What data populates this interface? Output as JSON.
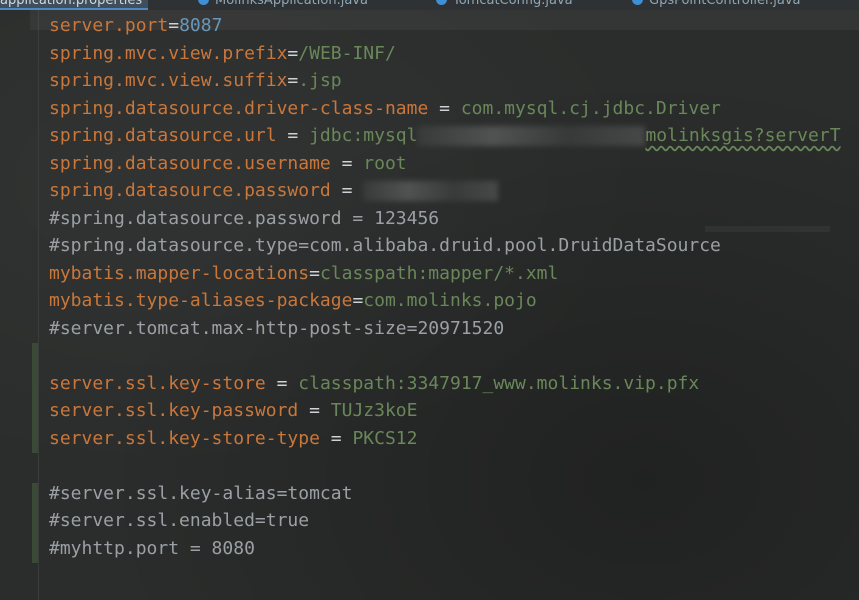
{
  "tabs": [
    {
      "label": "application.properties",
      "icon": "properties-file-icon",
      "active": true
    },
    {
      "label": "MolinksApplication.java",
      "icon": "java-class-icon",
      "active": false
    },
    {
      "label": "TomcatConfig.java",
      "icon": "java-class-icon",
      "active": false
    },
    {
      "label": "GpsPointController.java",
      "icon": "java-class-icon",
      "active": false
    }
  ],
  "lines": [
    {
      "key": "server.port",
      "sep": "=",
      "value": "8087"
    },
    {
      "key": "spring.mvc.view.prefix",
      "sep": "=",
      "value": "/WEB-INF/"
    },
    {
      "key": "spring.mvc.view.suffix",
      "sep": "=",
      "value": ".jsp"
    },
    {
      "key": "spring.datasource.driver-class-name",
      "sep": " = ",
      "value": "com.mysql.cj.jdbc.Driver"
    },
    {
      "key": "spring.datasource.url",
      "sep": " = ",
      "value": "jdbc:mysql",
      "value_tail": "molinksgis?serverT"
    },
    {
      "key": "spring.datasource.username",
      "sep": " = ",
      "value": "root"
    },
    {
      "key": "spring.datasource.password",
      "sep": " = ",
      "value": ""
    },
    {
      "comment": "#spring.datasource.password = 123456"
    },
    {
      "comment": "#spring.datasource.type=com.alibaba.druid.pool.DruidDataSource"
    },
    {
      "key": "mybatis.mapper-locations",
      "sep": "=",
      "value": "classpath:mapper/*.xml"
    },
    {
      "key": "mybatis.type-aliases-package",
      "sep": "=",
      "value": "com.molinks.pojo"
    },
    {
      "comment": "#server.tomcat.max-http-post-size=20971520"
    },
    {
      "blank": true
    },
    {
      "key": "server.ssl.key-store",
      "sep": " = ",
      "value": "classpath:3347917_www.molinks.vip.pfx"
    },
    {
      "key": "server.ssl.key-password",
      "sep": " = ",
      "value": "TUJz3koE"
    },
    {
      "key": "server.ssl.key-store-type",
      "sep": " = ",
      "value": "PKCS12"
    },
    {
      "blank": true
    },
    {
      "comment": "#server.ssl.key-alias=tomcat"
    },
    {
      "comment": "#server.ssl.enabled=true"
    },
    {
      "comment": "#myhttp.port = 8080"
    }
  ],
  "colors": {
    "key": "#c9773b",
    "value": "#6a8759",
    "number": "#6897bb",
    "comment": "#9aa0a4",
    "background": "#2b2d2c"
  }
}
